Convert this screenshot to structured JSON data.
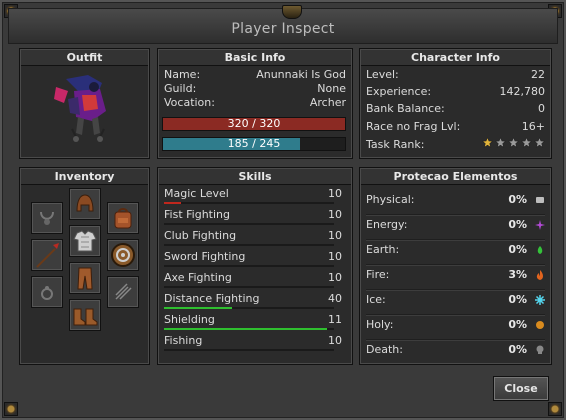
{
  "window": {
    "title": "Player Inspect"
  },
  "outfit": {
    "header": "Outfit"
  },
  "basic_info": {
    "header": "Basic Info",
    "rows": [
      {
        "label": "Name:",
        "value": "Anunnaki Is God"
      },
      {
        "label": "Guild:",
        "value": "None"
      },
      {
        "label": "Vocation:",
        "value": "Archer"
      }
    ],
    "health": {
      "text": "320 / 320",
      "fraction": 1.0,
      "color": "#8b2a23"
    },
    "mana": {
      "text": "185 / 245",
      "fraction": 0.755,
      "color": "#2f7c8c"
    }
  },
  "character_info": {
    "header": "Character Info",
    "rows": [
      {
        "label": "Level:",
        "value": "22"
      },
      {
        "label": "Experience:",
        "value": "142,780"
      },
      {
        "label": "Bank Balance:",
        "value": "0"
      },
      {
        "label": "Race no Frag Lvl:",
        "value": "16+"
      }
    ],
    "task_rank": {
      "label": "Task Rank:",
      "stars_filled": 1,
      "stars_total": 5
    }
  },
  "inventory": {
    "header": "Inventory",
    "slots": [
      {
        "name": "amulet-slot",
        "icon": "necklace-icon"
      },
      {
        "name": "helmet-slot",
        "icon": "leather-helmet-icon"
      },
      {
        "name": "backpack-slot",
        "icon": "backpack-icon"
      },
      {
        "name": "weapon-slot",
        "icon": "spear-icon"
      },
      {
        "name": "armor-slot",
        "icon": "plate-armor-icon"
      },
      {
        "name": "shield-slot",
        "icon": "round-shield-icon"
      },
      {
        "name": "ring-slot",
        "icon": "ring-icon"
      },
      {
        "name": "legs-slot",
        "icon": "leather-legs-icon"
      },
      {
        "name": "ammo-slot",
        "icon": "ammo-icon"
      },
      {
        "name": "boots-slot",
        "icon": "leather-boots-icon"
      }
    ]
  },
  "skills": {
    "header": "Skills",
    "rows": [
      {
        "name": "Magic Level",
        "level": "10",
        "progress": 0.1,
        "color": "#c0271d"
      },
      {
        "name": "Fist Fighting",
        "level": "10",
        "progress": 0,
        "color": "#2fbf2f"
      },
      {
        "name": "Club Fighting",
        "level": "10",
        "progress": 0,
        "color": "#2fbf2f"
      },
      {
        "name": "Sword Fighting",
        "level": "10",
        "progress": 0,
        "color": "#2fbf2f"
      },
      {
        "name": "Axe Fighting",
        "level": "10",
        "progress": 0,
        "color": "#2fbf2f"
      },
      {
        "name": "Distance Fighting",
        "level": "40",
        "progress": 0.4,
        "color": "#2fbf2f"
      },
      {
        "name": "Shielding",
        "level": "11",
        "progress": 0.96,
        "color": "#2fbf2f"
      },
      {
        "name": "Fishing",
        "level": "10",
        "progress": 0,
        "color": "#2fbf2f"
      }
    ]
  },
  "elements": {
    "header": "Protecao Elementos",
    "rows": [
      {
        "name": "Physical:",
        "value": "0%",
        "value_color": "#e8e8e8",
        "icon": "fist-icon",
        "icon_color": "#bdbdbd"
      },
      {
        "name": "Energy:",
        "value": "0%",
        "value_color": "#e8e8e8",
        "icon": "energy-icon",
        "icon_color": "#b34ad6"
      },
      {
        "name": "Earth:",
        "value": "0%",
        "value_color": "#e8e8e8",
        "icon": "earth-icon",
        "icon_color": "#34c23a"
      },
      {
        "name": "Fire:",
        "value": "3%",
        "value_color": "#e8e8e8",
        "icon": "fire-icon",
        "icon_color": "#e2641e"
      },
      {
        "name": "Ice:",
        "value": "0%",
        "value_color": "#e8e8e8",
        "icon": "ice-icon",
        "icon_color": "#54d6ee"
      },
      {
        "name": "Holy:",
        "value": "0%",
        "value_color": "#e8e8e8",
        "icon": "holy-icon",
        "icon_color": "#d98b1e"
      },
      {
        "name": "Death:",
        "value": "0%",
        "value_color": "#e8e8e8",
        "icon": "death-icon",
        "icon_color": "#888888"
      }
    ]
  },
  "buttons": {
    "close_label": "Close"
  }
}
